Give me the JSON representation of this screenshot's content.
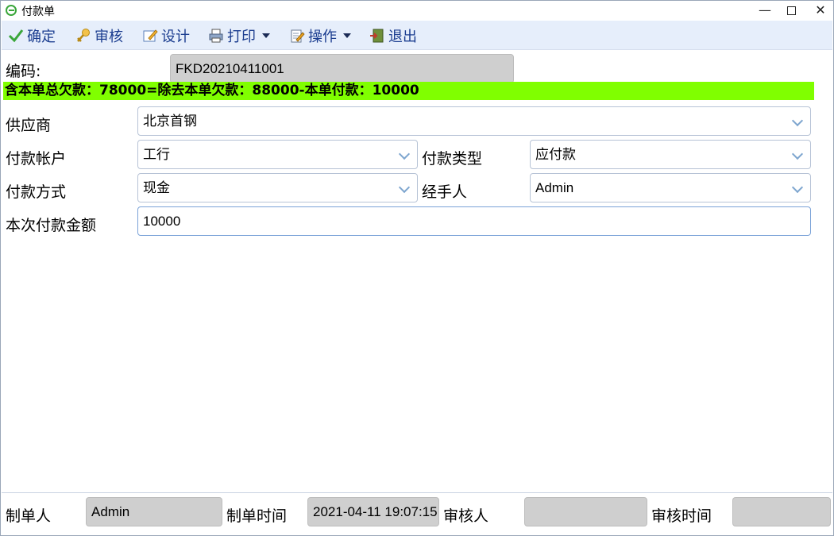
{
  "window": {
    "title": "付款单"
  },
  "toolbar": {
    "confirm": "确定",
    "audit": "审核",
    "design": "设计",
    "print": "打印",
    "operate": "操作",
    "exit": "退出"
  },
  "form": {
    "code_label": "编码:",
    "code_value": "FKD20210411001",
    "summary": "含本单总欠款：78000=除去本单欠款：88000-本单付款：10000",
    "supplier_label": "供应商",
    "supplier_value": "北京首钢",
    "account_label": "付款帐户",
    "account_value": "工行",
    "type_label": "付款类型",
    "type_value": "应付款",
    "method_label": "付款方式",
    "method_value": "现金",
    "handler_label": "经手人",
    "handler_value": "Admin",
    "amount_label": "本次付款金额",
    "amount_value": "10000"
  },
  "footer": {
    "creator_label": "制单人",
    "creator_value": "Admin",
    "created_time_label": "制单时间",
    "created_time_value": "2021-04-11 19:07:15",
    "auditor_label": "审核人",
    "auditor_value": "",
    "audit_time_label": "审核时间",
    "audit_time_value": ""
  },
  "colors": {
    "toolbar_bg": "#e6eefb",
    "summary_bg": "#80ff00",
    "readonly_bg": "#cfcfcf",
    "toolbar_text": "#1a3c8f"
  }
}
